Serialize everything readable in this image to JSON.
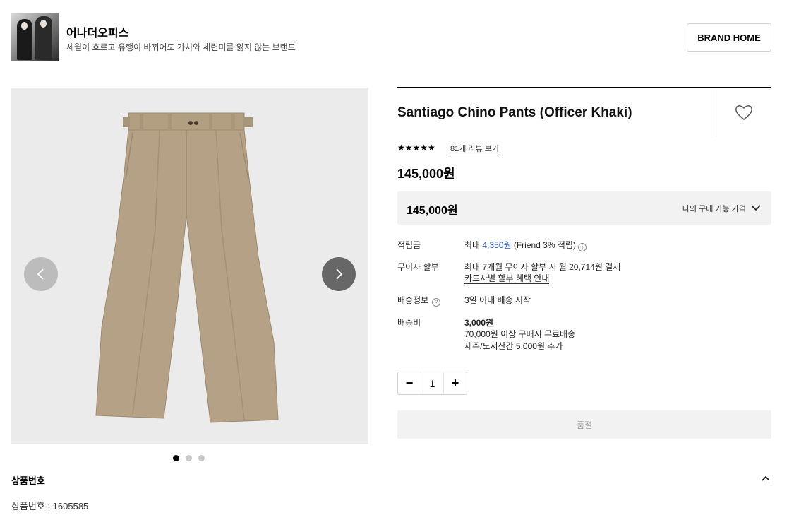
{
  "brand": {
    "name": "어나더오피스",
    "description": "세월이 흐르고 유행이 바뀌어도 가치와 세련미를 잃지 않는 브랜드",
    "home_button": "BRAND HOME"
  },
  "gallery": {
    "image_count": 3,
    "active_index": 0
  },
  "product": {
    "title": "Santiago Chino Pants (Officer Khaki)",
    "rating_stars": "★★★★★",
    "rating": 5,
    "review_link": "81개 리뷰 보기",
    "price": "145,000원"
  },
  "price_box": {
    "price": "145,000원",
    "label": "나의 구매 가능 가격"
  },
  "details": {
    "points": {
      "label": "적립금",
      "prefix": "최대 ",
      "amount": "4,350원",
      "suffix": " (Friend 3% 적립)"
    },
    "installment": {
      "label": "무이자 할부",
      "line1": "최대 7개월 무이자 할부 시 월 20,714원 결제",
      "link": "카드사별 할부 혜택 안내"
    },
    "delivery_info": {
      "label": "배송정보",
      "value": "3일 이내 배송 시작"
    },
    "shipping_fee": {
      "label": "배송비",
      "amount": "3,000원",
      "line2": "70,000원 이상 구매시 무료배송",
      "line3": "제주/도서산간 5,000원 추가"
    }
  },
  "quantity": {
    "minus": "−",
    "value": "1",
    "plus": "+"
  },
  "soldout_button": "품절",
  "section": {
    "title": "상품번호",
    "value": "상품번호 : 1605585"
  },
  "colors": {
    "khaki": "#b5a286",
    "gallery_bg": "#ebebeb",
    "link_blue": "#2c5bd4"
  }
}
